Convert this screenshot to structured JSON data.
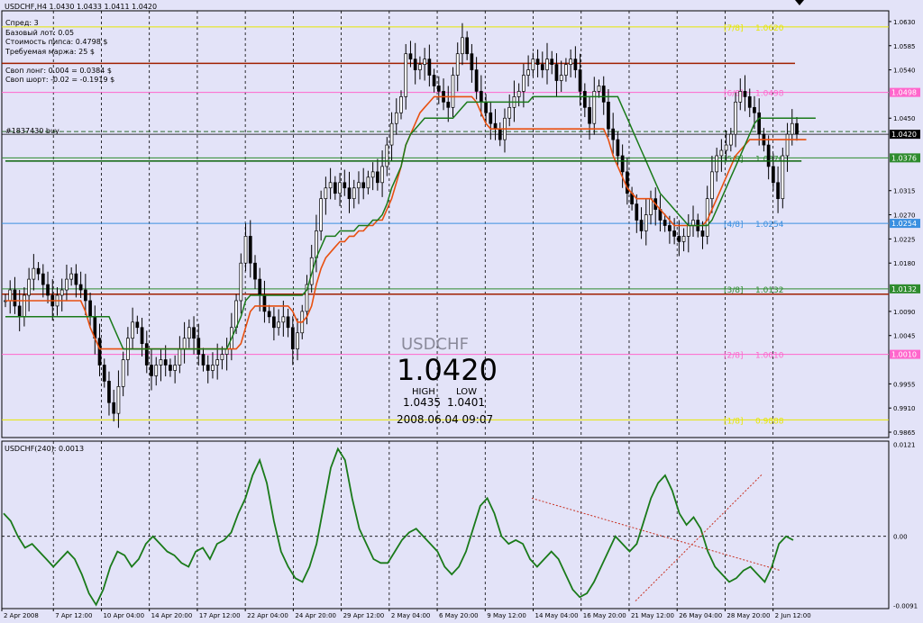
{
  "header": {
    "symbol_line": "USDCHF,H4  1.0430 1.0433 1.0411 1.0420",
    "info_lines": [
      "Спред: 3",
      "Базовый лот: 0.05",
      "Стоимость пипса: 0.4798 $",
      "Требуемая маржа: 25 $",
      "",
      "Своп лонг: 0.004 = 0.0384 $",
      "Своп шорт: -0.02 = -0.1919 $"
    ],
    "order_label": "#1837430 buy"
  },
  "overlay": {
    "symbol": "USDCHF",
    "price": "1.0420",
    "high_label": "HIGH",
    "low_label": "LOW",
    "high_value": "1.0435",
    "low_value": "1.0401",
    "datetime": "2008.06.04 09:07"
  },
  "murrey_levels": [
    {
      "label": "[7/8]",
      "value": "1.0620",
      "price": 1.062,
      "color": "#e6e600",
      "show_label": true,
      "badge": false
    },
    {
      "label": "[6/8]",
      "value": "1.0498",
      "price": 1.0498,
      "color": "#ff66cc",
      "show_label": true,
      "badge": true
    },
    {
      "label": "[5/8]",
      "value": "1.0376",
      "price": 1.0376,
      "color": "#2e8b2e",
      "show_label": true,
      "badge": true
    },
    {
      "label": "[4/8]",
      "value": "1.0254",
      "price": 1.0254,
      "color": "#3a8fe0",
      "show_label": true,
      "badge": true
    },
    {
      "label": "[3/8]",
      "value": "1.0132",
      "price": 1.0132,
      "color": "#2e8b2e",
      "show_label": true,
      "badge": true
    },
    {
      "label": "[2/8]",
      "value": "1.0010",
      "price": 1.001,
      "color": "#ff66cc",
      "show_label": true,
      "badge": true
    },
    {
      "label": "[1/8]",
      "value": "0.9888",
      "price": 0.9888,
      "color": "#e6e600",
      "show_label": true,
      "badge": false
    }
  ],
  "price_axis_ticks": [
    "1.0630",
    "1.0585",
    "1.0540",
    "1.0450",
    "1.0315",
    "1.0270",
    "1.0225",
    "1.0180",
    "1.0090",
    "1.0045",
    "0.9955",
    "0.9910",
    "0.9865"
  ],
  "current_price": "1.0420",
  "x_axis_labels": [
    "2 Apr 2008",
    "7 Apr 12:00",
    "10 Apr 04:00",
    "14 Apr 20:00",
    "17 Apr 12:00",
    "22 Apr 04:00",
    "24 Apr 20:00",
    "29 Apr 12:00",
    "2 May 04:00",
    "6 May 20:00",
    "9 May 12:00",
    "14 May 04:00",
    "16 May 20:00",
    "21 May 12:00",
    "26 May 04:00",
    "28 May 20:00",
    "2 Jun 12:00"
  ],
  "indicator": {
    "label": "USDCHF(240):  0.0013",
    "ticks": [
      "0.0121",
      "0.00",
      "-0.0091"
    ]
  },
  "chart_data": [
    {
      "type": "candlestick",
      "title": "USDCHF,H4",
      "ylim": [
        0.9855,
        1.065
      ],
      "grid": true,
      "closes": [
        1.011,
        1.013,
        1.01,
        1.008,
        1.012,
        1.015,
        1.017,
        1.016,
        1.014,
        1.012,
        1.01,
        1.012,
        1.013,
        1.015,
        1.016,
        1.014,
        1.013,
        1.011,
        1.008,
        1.004,
        0.999,
        0.996,
        0.992,
        0.99,
        0.995,
        1.0,
        1.004,
        1.007,
        1.006,
        1.003,
        0.999,
        0.997,
        0.999,
        1.0,
        0.999,
        0.998,
        0.999,
        1.002,
        1.004,
        1.006,
        1.004,
        1.001,
        0.999,
        0.998,
        0.999,
        1.0,
        1.001,
        1.002,
        1.006,
        1.011,
        1.018,
        1.023,
        1.018,
        1.015,
        1.012,
        1.009,
        1.008,
        1.006,
        1.007,
        1.008,
        1.006,
        1.002,
        1.005,
        1.009,
        1.014,
        1.019,
        1.024,
        1.03,
        1.032,
        1.033,
        1.031,
        1.033,
        1.032,
        1.03,
        1.032,
        1.033,
        1.032,
        1.034,
        1.035,
        1.033,
        1.036,
        1.04,
        1.044,
        1.046,
        1.049,
        1.057,
        1.056,
        1.054,
        1.055,
        1.056,
        1.053,
        1.051,
        1.05,
        1.048,
        1.047,
        1.053,
        1.057,
        1.06,
        1.057,
        1.054,
        1.05,
        1.048,
        1.046,
        1.044,
        1.043,
        1.041,
        1.045,
        1.047,
        1.049,
        1.05,
        1.053,
        1.054,
        1.056,
        1.055,
        1.054,
        1.056,
        1.055,
        1.052,
        1.053,
        1.055,
        1.056,
        1.054,
        1.05,
        1.047,
        1.044,
        1.05,
        1.051,
        1.048,
        1.043,
        1.041,
        1.038,
        1.035,
        1.031,
        1.029,
        1.026,
        1.024,
        1.027,
        1.03,
        1.028,
        1.026,
        1.025,
        1.024,
        1.023,
        1.022,
        1.023,
        1.025,
        1.026,
        1.024,
        1.023,
        1.03,
        1.035,
        1.038,
        1.039,
        1.04,
        1.042,
        1.048,
        1.05,
        1.049,
        1.047,
        1.046,
        1.042,
        1.04,
        1.036,
        1.033,
        1.03,
        1.038,
        1.042,
        1.044,
        1.042
      ],
      "series": [
        {
          "name": "",
          "color": "#e85010",
          "values": [
            1.011,
            1.011,
            1.011,
            1.011,
            1.011,
            1.011,
            1.011,
            1.011,
            1.011,
            1.011,
            1.011,
            1.011,
            1.011,
            1.011,
            1.011,
            1.011,
            1.011,
            1.009,
            1.006,
            1.004,
            1.002,
            1.002,
            1.002,
            1.002,
            1.002,
            1.002,
            1.002,
            1.002,
            1.002,
            1.002,
            1.002,
            1.002,
            1.002,
            1.002,
            1.002,
            1.002,
            1.002,
            1.002,
            1.002,
            1.002,
            1.002,
            1.002,
            1.002,
            1.002,
            1.002,
            1.002,
            1.002,
            1.002,
            1.002,
            1.002,
            1.003,
            1.006,
            1.009,
            1.01,
            1.01,
            1.01,
            1.01,
            1.01,
            1.01,
            1.01,
            1.01,
            1.009,
            1.007,
            1.007,
            1.008,
            1.01,
            1.014,
            1.017,
            1.019,
            1.02,
            1.021,
            1.022,
            1.022,
            1.023,
            1.023,
            1.024,
            1.024,
            1.025,
            1.025,
            1.026,
            1.026,
            1.028,
            1.03,
            1.033,
            1.036,
            1.04,
            1.042,
            1.044,
            1.046,
            1.047,
            1.048,
            1.049,
            1.049,
            1.049,
            1.049,
            1.049,
            1.049,
            1.049,
            1.049,
            1.049,
            1.048,
            1.046,
            1.044,
            1.043,
            1.043,
            1.043,
            1.043,
            1.043,
            1.043,
            1.043,
            1.043,
            1.043,
            1.043,
            1.043,
            1.043,
            1.043,
            1.043,
            1.043,
            1.043,
            1.043,
            1.043,
            1.043,
            1.043,
            1.043,
            1.043,
            1.043,
            1.043,
            1.043,
            1.041,
            1.038,
            1.036,
            1.034,
            1.032,
            1.031,
            1.03,
            1.03,
            1.03,
            1.03,
            1.029,
            1.028,
            1.027,
            1.026,
            1.025,
            1.025,
            1.025,
            1.025,
            1.025,
            1.025,
            1.025,
            1.026,
            1.028,
            1.03,
            1.032,
            1.034,
            1.036,
            1.038,
            1.039,
            1.04,
            1.041,
            1.041,
            1.041,
            1.041,
            1.041,
            1.041,
            1.041,
            1.041,
            1.041,
            1.041,
            1.041,
            1.041,
            1.041
          ]
        },
        {
          "name": "",
          "color": "#1a7a1a",
          "values": [
            1.008,
            1.008,
            1.008,
            1.008,
            1.008,
            1.008,
            1.008,
            1.008,
            1.008,
            1.008,
            1.008,
            1.008,
            1.008,
            1.008,
            1.008,
            1.008,
            1.008,
            1.008,
            1.008,
            1.008,
            1.008,
            1.008,
            1.008,
            1.006,
            1.004,
            1.002,
            1.002,
            1.002,
            1.002,
            1.002,
            1.002,
            1.002,
            1.002,
            1.002,
            1.002,
            1.002,
            1.002,
            1.002,
            1.002,
            1.002,
            1.002,
            1.002,
            1.002,
            1.002,
            1.002,
            1.002,
            1.002,
            1.002,
            1.004,
            1.006,
            1.008,
            1.011,
            1.012,
            1.012,
            1.012,
            1.012,
            1.012,
            1.012,
            1.012,
            1.012,
            1.012,
            1.012,
            1.012,
            1.012,
            1.013,
            1.016,
            1.019,
            1.021,
            1.023,
            1.023,
            1.023,
            1.024,
            1.024,
            1.024,
            1.024,
            1.025,
            1.025,
            1.025,
            1.026,
            1.026,
            1.027,
            1.029,
            1.032,
            1.034,
            1.036,
            1.04,
            1.042,
            1.043,
            1.044,
            1.045,
            1.045,
            1.045,
            1.045,
            1.045,
            1.045,
            1.045,
            1.046,
            1.047,
            1.048,
            1.048,
            1.048,
            1.048,
            1.048,
            1.048,
            1.048,
            1.048,
            1.048,
            1.048,
            1.048,
            1.048,
            1.048,
            1.048,
            1.049,
            1.049,
            1.049,
            1.049,
            1.049,
            1.049,
            1.049,
            1.049,
            1.049,
            1.049,
            1.049,
            1.049,
            1.049,
            1.049,
            1.049,
            1.049,
            1.049,
            1.049,
            1.049,
            1.047,
            1.045,
            1.043,
            1.041,
            1.039,
            1.037,
            1.035,
            1.033,
            1.031,
            1.03,
            1.029,
            1.028,
            1.027,
            1.026,
            1.025,
            1.025,
            1.025,
            1.025,
            1.025,
            1.026,
            1.028,
            1.03,
            1.032,
            1.034,
            1.036,
            1.038,
            1.04,
            1.042,
            1.044,
            1.045,
            1.045,
            1.045,
            1.045,
            1.045,
            1.045,
            1.045,
            1.045,
            1.045,
            1.045,
            1.045,
            1.045,
            1.045
          ]
        },
        {
          "name": "",
          "color": "#0a640a",
          "values": [
            1.037,
            1.037,
            1.037,
            1.037,
            1.037,
            1.037,
            1.037,
            1.037,
            1.037,
            1.037,
            1.037,
            1.037,
            1.037,
            1.037,
            1.037,
            1.037,
            1.037,
            1.037,
            1.037,
            1.037,
            1.037,
            1.037,
            1.037,
            1.037,
            1.037,
            1.037,
            1.037,
            1.037,
            1.037,
            1.037,
            1.037,
            1.037,
            1.037,
            1.037,
            1.037,
            1.037,
            1.037,
            1.037,
            1.037,
            1.037,
            1.037,
            1.037,
            1.037,
            1.037,
            1.037,
            1.037,
            1.037,
            1.037,
            1.037,
            1.037,
            1.037,
            1.037,
            1.037,
            1.037,
            1.037,
            1.037,
            1.037,
            1.037,
            1.037,
            1.037,
            1.037,
            1.037,
            1.037,
            1.037,
            1.037,
            1.037,
            1.037,
            1.037,
            1.037,
            1.037,
            1.037,
            1.037,
            1.037,
            1.037,
            1.037,
            1.037,
            1.037,
            1.037,
            1.037,
            1.037,
            1.037,
            1.037,
            1.037,
            1.037,
            1.037,
            1.037,
            1.037,
            1.037,
            1.037,
            1.037,
            1.037,
            1.037,
            1.037,
            1.037,
            1.037,
            1.037,
            1.037,
            1.037,
            1.037,
            1.037,
            1.037,
            1.037,
            1.037,
            1.037,
            1.037,
            1.037,
            1.037,
            1.037,
            1.037,
            1.037,
            1.037,
            1.037,
            1.037,
            1.037,
            1.037,
            1.037,
            1.037,
            1.037,
            1.037,
            1.037,
            1.037,
            1.037,
            1.037,
            1.037,
            1.037,
            1.037,
            1.037,
            1.037,
            1.037,
            1.037,
            1.037,
            1.037,
            1.037,
            1.037,
            1.037,
            1.037,
            1.037,
            1.037,
            1.037,
            1.037,
            1.037,
            1.037,
            1.037,
            1.037,
            1.037,
            1.037,
            1.037,
            1.037,
            1.037,
            1.037,
            1.037,
            1.037,
            1.037,
            1.037,
            1.037,
            1.037,
            1.037,
            1.037,
            1.037,
            1.037,
            1.037,
            1.037,
            1.037,
            1.037,
            1.037,
            1.037,
            1.037,
            1.037,
            1.037,
            1.037
          ]
        }
      ]
    },
    {
      "type": "line",
      "title": "USDCHF(240):  0.0013",
      "ylim": [
        -0.0095,
        0.0125
      ],
      "zero_line": true,
      "values": [
        0.003,
        0.002,
        0.0,
        -0.0015,
        -0.001,
        -0.002,
        -0.003,
        -0.004,
        -0.003,
        -0.002,
        -0.003,
        -0.005,
        -0.0075,
        -0.009,
        -0.007,
        -0.004,
        -0.002,
        -0.0025,
        -0.004,
        -0.003,
        -0.001,
        0.0,
        -0.001,
        -0.002,
        -0.0025,
        -0.0035,
        -0.004,
        -0.002,
        -0.0015,
        -0.003,
        -0.001,
        -0.0005,
        0.0005,
        0.003,
        0.005,
        0.008,
        0.01,
        0.007,
        0.002,
        -0.002,
        -0.004,
        -0.0055,
        -0.006,
        -0.004,
        -0.001,
        0.004,
        0.009,
        0.0115,
        0.01,
        0.005,
        0.001,
        -0.001,
        -0.003,
        -0.0035,
        -0.0035,
        -0.002,
        -0.0005,
        0.0005,
        0.001,
        0.0,
        -0.001,
        -0.002,
        -0.004,
        -0.005,
        -0.004,
        -0.002,
        0.001,
        0.004,
        0.005,
        0.003,
        0.0,
        -0.001,
        -0.0005,
        -0.001,
        -0.003,
        -0.004,
        -0.003,
        -0.002,
        -0.003,
        -0.005,
        -0.007,
        -0.008,
        -0.0075,
        -0.006,
        -0.004,
        -0.002,
        0.0,
        -0.001,
        -0.002,
        -0.001,
        0.002,
        0.005,
        0.007,
        0.008,
        0.006,
        0.003,
        0.0015,
        0.0025,
        0.001,
        -0.002,
        -0.004,
        -0.005,
        -0.006,
        -0.0055,
        -0.0045,
        -0.004,
        -0.005,
        -0.006,
        -0.004,
        -0.001,
        0.0,
        -0.0005
      ]
    }
  ]
}
